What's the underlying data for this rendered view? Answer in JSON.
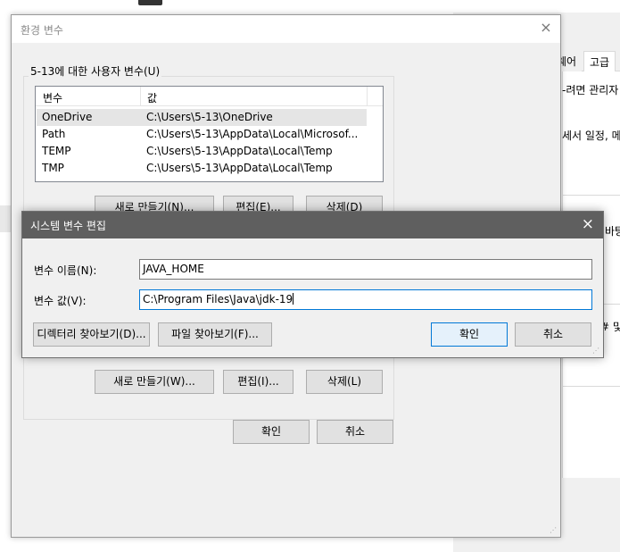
{
  "background_window": {
    "tabs": [
      "웨어",
      "고급"
    ],
    "lines": [
      "-려면 관리자",
      "세서 일정, 메",
      "바탕",
      "# 및"
    ]
  },
  "env_dialog": {
    "title": "환경 변수",
    "user_group_label": "5-13에 대한 사용자 변수(U)",
    "columns": [
      "변수",
      "값"
    ],
    "rows": [
      {
        "name": "OneDrive",
        "value": "C:\\Users\\5-13\\OneDrive"
      },
      {
        "name": "Path",
        "value": "C:\\Users\\5-13\\AppData\\Local\\Microsof..."
      },
      {
        "name": "TEMP",
        "value": "C:\\Users\\5-13\\AppData\\Local\\Temp"
      },
      {
        "name": "TMP",
        "value": "C:\\Users\\5-13\\AppData\\Local\\Temp"
      }
    ],
    "user_buttons": {
      "new": "새로 만들기(N)...",
      "edit": "편집(E)...",
      "delete": "삭제(D)"
    },
    "system_buttons": {
      "new": "새로 만들기(W)...",
      "edit": "편집(I)...",
      "delete": "삭제(L)"
    },
    "ok": "확인",
    "cancel": "취소"
  },
  "edit_dialog": {
    "title": "시스템 변수 편집",
    "name_label": "변수 이름(N):",
    "name_value": "JAVA_HOME",
    "value_label": "변수 값(V):",
    "value_value": "C:\\Program Files\\Java\\jdk-19",
    "browse_dir": "디렉터리 찾아보기(D)...",
    "browse_file": "파일 찾아보기(F)...",
    "ok": "확인",
    "cancel": "취소"
  },
  "icons": {
    "close": "×",
    "grip": "⋰"
  }
}
